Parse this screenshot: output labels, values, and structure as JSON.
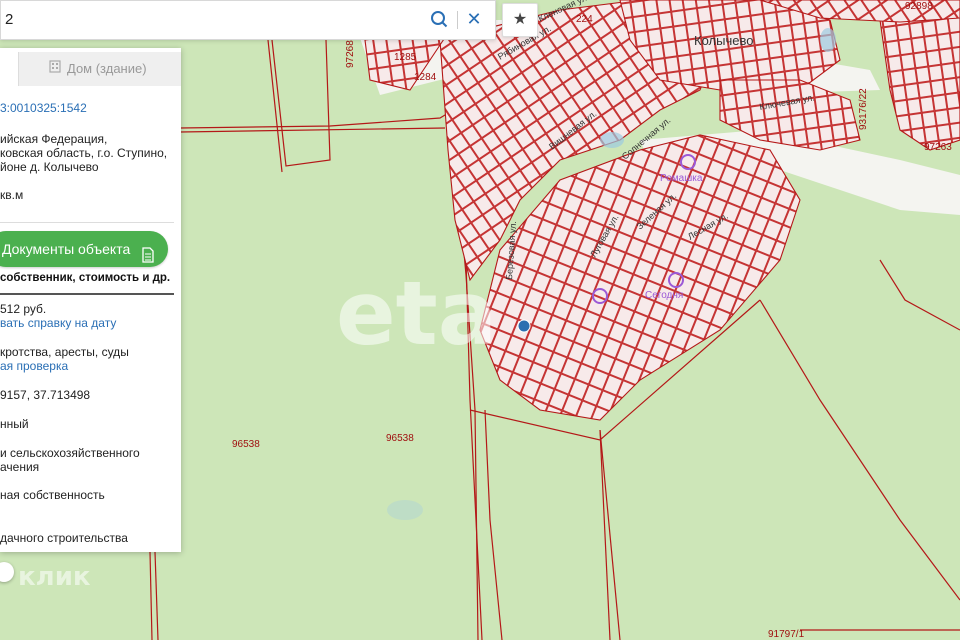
{
  "search": {
    "query": "2"
  },
  "panel": {
    "tab_building": "Дом (здание)",
    "cadastral_number": "3:0010325:1542",
    "address_lines": [
      "ийская Федерация,",
      "ковская область, г.о. Ступино,",
      "йоне д. Колычево"
    ],
    "area_unit": "кв.м",
    "documents_button": "Документы объекта",
    "documents_subtitle": "собственник, стоимость и др.",
    "cadastral_value": "512 руб.",
    "certificate_link": "вать справку на дату",
    "restrictions_label": "кротства, аресты, суды",
    "check_link": "ая проверка",
    "coordinates": "9157, 37.713498",
    "status": "нный",
    "category_lines": [
      "и сельскохозяйственного",
      "ачения"
    ],
    "ownership": "ная собственность",
    "permitted_use": "дачного строительства"
  },
  "map": {
    "place_name": "Колычево",
    "parcel_labels": [
      "224",
      "1285",
      "1284",
      "97268",
      "92898",
      "93176/22",
      "97263",
      "96538",
      "96538",
      "91797/1"
    ],
    "street_labels": [
      "Березовая ул.",
      "Вишневая ул.",
      "Ключевая ул.",
      "Солнечная ул.",
      "Луговая ул.",
      "Зеленая ул.",
      "Лесная ул.",
      "Рябиновая ул.",
      "Кленовая ул."
    ],
    "poi_labels": [
      "Ромашка",
      "Сегодня"
    ],
    "watermark_main": "eta",
    "watermark_small": "клик"
  },
  "colors": {
    "map_green": "#cde6b8",
    "parcel_fill": "#f7eaea",
    "parcel_stroke": "#c02020",
    "road": "#f3f3f3",
    "accent_green": "#4bb04f",
    "link_blue": "#2a6fb5",
    "poi_purple": "#9b59d6"
  },
  "icons": [
    "search-icon",
    "close-icon",
    "star-icon",
    "building-icon",
    "document-icon",
    "location-marker-icon"
  ]
}
